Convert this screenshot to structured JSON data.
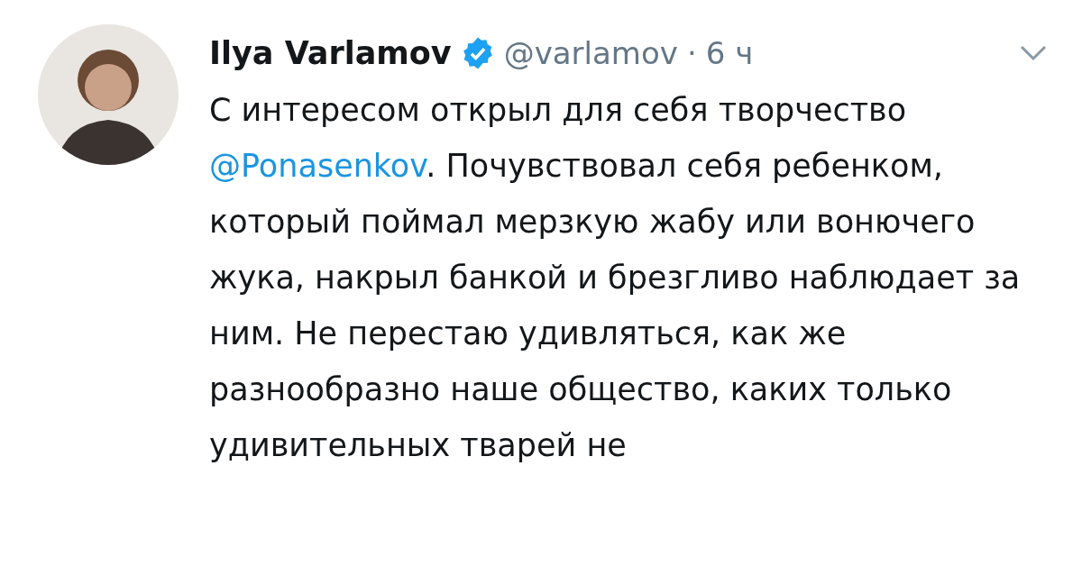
{
  "tweet": {
    "author": {
      "name": "Ilya Varlamov",
      "verified": true,
      "handle": "@varlamov",
      "separator": "·",
      "time": "6 ч"
    },
    "body": [
      {
        "kind": "text",
        "text": "С интересом открыл для себя творчество "
      },
      {
        "kind": "mention",
        "text": "@Ponasenkov"
      },
      {
        "kind": "text",
        "text": ". Почувствовал себя ребенком, который поймал мерзкую жабу или вонючего жука, накрыл банкой и брезгливо наблюдает за ним. Не перестаю удивляться, как же разнообразно наше общество, каких только удивительных тварей не"
      }
    ]
  }
}
